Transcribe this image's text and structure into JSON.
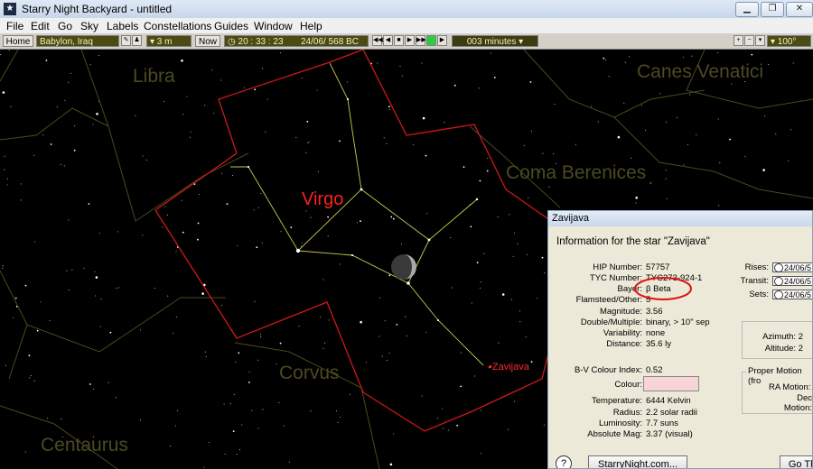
{
  "window": {
    "title": "Starry Night Backyard - untitled",
    "controls": [
      "minimize",
      "restore",
      "close"
    ]
  },
  "menu": [
    "File",
    "Edit",
    "Go",
    "Sky",
    "Labels",
    "Constellations",
    "Guides",
    "Window",
    "Help"
  ],
  "toolbar": {
    "home_label": "Home",
    "location": "Babylon, Iraq",
    "elevation": "▾ 3 m",
    "now_label": "Now",
    "time": "20 : 33 : 23",
    "date": "24/06/   568 BC",
    "step": "003 minutes ▾",
    "zoom": "▾ 100°"
  },
  "sky": {
    "constellations": {
      "libra": "Libra",
      "canes_venatici": "Canes Venatici",
      "coma_berenices": "Coma Berenices",
      "virgo": "Virgo",
      "corvus": "Corvus",
      "centaurus": "Centaurus"
    },
    "star_label": "•Zavijava",
    "colors": {
      "boundary": "#d01818",
      "figure": "#c8c84a",
      "dim_line": "#4a4a1e",
      "label": "#4b4a21",
      "virgo_label": "#ff1f1f"
    }
  },
  "info_panel": {
    "title": "Zavijava",
    "heading": "Information for  the star \"Zavijava\"",
    "fields": [
      {
        "label": "HIP Number:",
        "value": "57757"
      },
      {
        "label": "TYC Number:",
        "value": "TYC273-924-1"
      },
      {
        "label": "Bayer:",
        "value": "β   Beta"
      },
      {
        "label": "Flamsteed/Other:",
        "value": "5"
      },
      {
        "label": "Magnitude:",
        "value": "3.56"
      },
      {
        "label": "Double/Multiple:",
        "value": "binary, > 10\" sep"
      },
      {
        "label": "Variability:",
        "value": "none"
      },
      {
        "label": "Distance:",
        "value": "35.6 ly"
      }
    ],
    "bv_label": "B-V Colour Index:",
    "bv_value": "0.52",
    "colour_label": "Colour:",
    "colour_swatch": "#f8d4d8",
    "physical": [
      {
        "label": "Temperature:",
        "value": "6444 Kelvin"
      },
      {
        "label": "Radius:",
        "value": "2.2 solar radii"
      },
      {
        "label": "Luminosity:",
        "value": "7.7 suns"
      },
      {
        "label": "Absolute Mag:",
        "value": "3.37 (visual)"
      }
    ],
    "times": [
      {
        "label": "Rises:",
        "value": "24/06/5"
      },
      {
        "label": "Transit:",
        "value": "24/06/5"
      },
      {
        "label": "Sets:",
        "value": "24/06/5"
      }
    ],
    "azimuth_label": "Azimuth:",
    "azimuth_value": "2",
    "altitude_label": "Altitude:",
    "altitude_value": "2",
    "proper_motion_title": "Proper Motion (fro",
    "ra_motion_label": "RA Motion:",
    "dec_motion_label": "Dec Motion:",
    "website_button": "StarryNight.com...",
    "goto_button": "Go Th",
    "help_label": "?"
  }
}
